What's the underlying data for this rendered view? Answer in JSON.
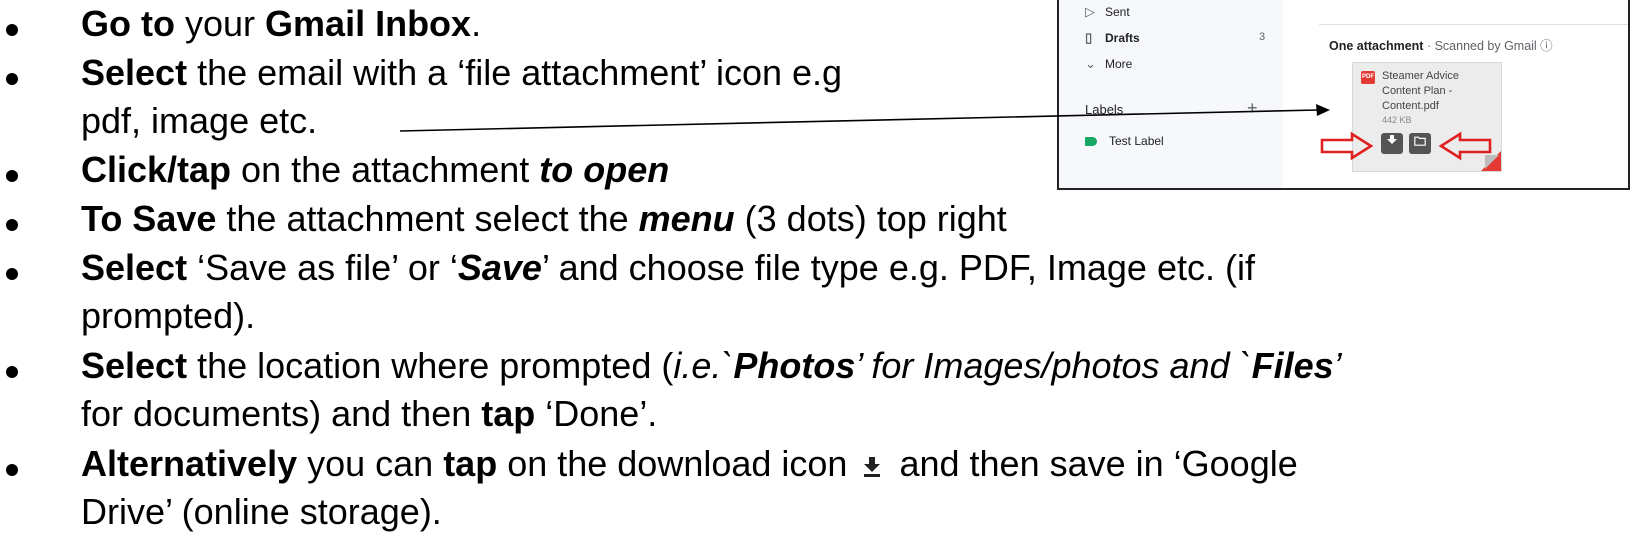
{
  "instructions": [
    {
      "parts": [
        {
          "t": "Go to",
          "b": true
        },
        {
          "t": " your "
        },
        {
          "t": "Gmail Inbox",
          "b": true
        },
        {
          "t": "."
        }
      ]
    },
    {
      "parts": [
        {
          "t": "Select",
          "b": true
        },
        {
          "t": " the email with a ‘file attachment’ icon e.g"
        }
      ]
    },
    {
      "parts": [
        {
          "t": "pdf, image etc."
        }
      ]
    },
    {
      "parts": [
        {
          "t": "Click/tap",
          "b": true
        },
        {
          "t": " on the attachment "
        },
        {
          "t": "to open",
          "b": true,
          "i": true
        }
      ]
    },
    {
      "parts": [
        {
          "t": "To Save",
          "b": true
        },
        {
          "t": " the attachment select the "
        },
        {
          "t": "menu",
          "b": true,
          "i": true
        },
        {
          "t": " (3 dots) top right"
        }
      ]
    },
    {
      "parts": [
        {
          "t": "Select",
          "b": true
        },
        {
          "t": " ‘Save as file’  or ‘"
        },
        {
          "t": "Save",
          "b": true,
          "i": true
        },
        {
          "t": "’ and choose file type e.g. PDF, Image etc. (if"
        }
      ]
    },
    {
      "parts": [
        {
          "t": "prompted)."
        }
      ]
    },
    {
      "parts": [
        {
          "t": "Select",
          "b": true
        },
        {
          "t": " the location where prompted ("
        },
        {
          "t": "i.e.`",
          "i": true
        },
        {
          "t": "Photos",
          "b": true,
          "i": true
        },
        {
          "t": "’ for Images/photos and `",
          "i": true
        },
        {
          "t": "Files",
          "b": true,
          "i": true
        },
        {
          "t": "’",
          "i": true
        }
      ]
    },
    {
      "parts": [
        {
          "t": "for documents) and then "
        },
        {
          "t": "tap",
          "b": true
        },
        {
          "t": " ‘Done’."
        }
      ]
    },
    {
      "parts": [
        {
          "t": "Alternatively",
          "b": true
        },
        {
          "t": " you can "
        },
        {
          "t": "tap",
          "b": true
        },
        {
          "t": " on the download icon "
        },
        {
          "icon": "download-icon"
        },
        {
          "t": " and then save in ‘Google"
        }
      ]
    },
    {
      "parts": [
        {
          "t": "Drive’ (online storage)."
        }
      ]
    }
  ],
  "gmail": {
    "sidebar": {
      "sent": "Sent",
      "drafts": "Drafts",
      "drafts_count": "3",
      "more": "More",
      "labels_heading": "Labels",
      "labels_add": "+",
      "test_label": "Test Label"
    },
    "attachment_header": "One attachment",
    "scanned_note": " ·  Scanned by Gmail ⓘ",
    "file_name": "Steamer Advice Content Plan - Content.pdf",
    "file_size": "442 KB",
    "pdf_badge": "PDF",
    "label_color": "#16a765",
    "pdf_color": "#e53935",
    "highlight_arrow_color": "#e02020"
  }
}
